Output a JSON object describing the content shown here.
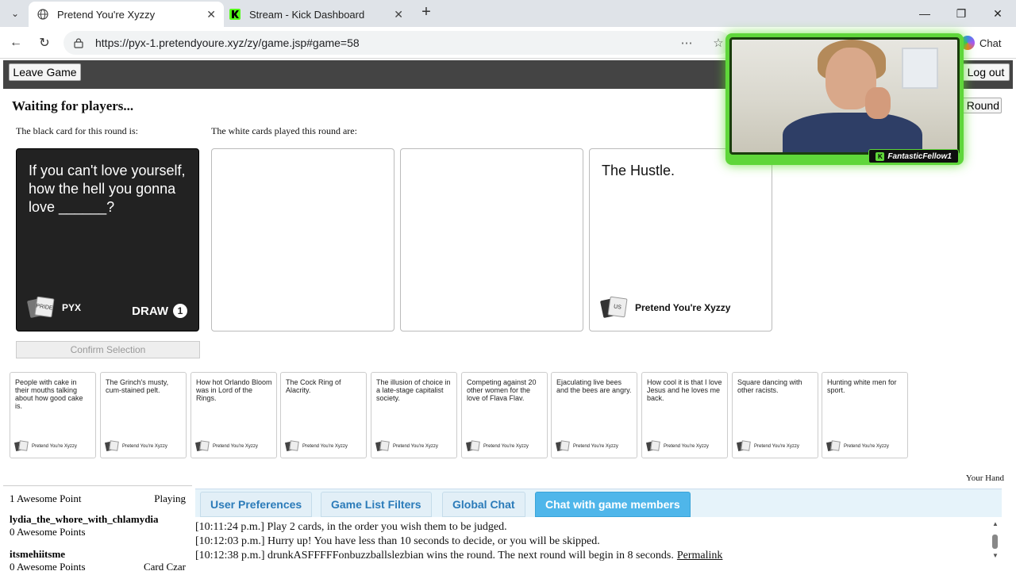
{
  "browser": {
    "tabs": [
      {
        "title": "Pretend You're Xyzzy",
        "active": true
      },
      {
        "title": "Stream - Kick Dashboard",
        "active": false
      }
    ],
    "url": "https://pyx-1.pretendyoure.xyz/zy/game.jsp#game=58",
    "chat_label": "Chat"
  },
  "game": {
    "leave_label": "Leave Game",
    "logout_label": "Log out",
    "round_label": "st Round",
    "status": "Waiting for players...",
    "black_caption": "The black card for this round is:",
    "white_caption": "The white cards played this round are:",
    "black_card": {
      "text": "If you can't love yourself, how the hell you gonna love ______?",
      "logo_text": "PRIDE",
      "brand": "PYX",
      "draw_label": "DRAW",
      "draw_count": "1"
    },
    "played_cards": [
      {
        "text": ""
      },
      {
        "text": ""
      },
      {
        "text": "The Hustle.",
        "logo_text": "US",
        "footer": "Pretend You're Xyzzy"
      }
    ],
    "confirm_label": "Confirm Selection",
    "your_hand_label": "Your Hand",
    "hand": [
      {
        "text": "People with cake in their mouths talking about how good cake is.",
        "footer": "Pretend You're Xyzzy"
      },
      {
        "text": "The Grinch's musty, cum-stained pelt.",
        "footer": "Pretend You're Xyzzy"
      },
      {
        "text": "How hot Orlando Bloom was in Lord of the Rings.",
        "footer": "Pretend You're Xyzzy"
      },
      {
        "text": "The Cock Ring of Alacrity.",
        "footer": "Pretend You're Xyzzy"
      },
      {
        "text": "The illusion of choice in a late-stage capitalist society.",
        "footer": "Pretend You're Xyzzy"
      },
      {
        "text": "Competing against 20 other women for the love of Flava Flav.",
        "footer": "Pretend You're Xyzzy"
      },
      {
        "text": "Ejaculating live bees and the bees are angry.",
        "footer": "Pretend You're Xyzzy"
      },
      {
        "text": "How cool it is that I love Jesus and he loves me back.",
        "footer": "Pretend You're Xyzzy"
      },
      {
        "text": "Square dancing with other racists.",
        "footer": "Pretend You're Xyzzy"
      },
      {
        "text": "Hunting white men for sport.",
        "footer": "Pretend You're Xyzzy"
      }
    ]
  },
  "scoreboard": {
    "rows": [
      {
        "name": "",
        "score": "1 Awesome Point",
        "status": "Playing"
      },
      {
        "name": "lydia_the_whore_with_chlamydia",
        "score": "0 Awesome Points",
        "status": ""
      },
      {
        "name": "itsmehiitsme",
        "score": "0 Awesome Points",
        "status": "Card Czar"
      }
    ]
  },
  "panel_tabs": [
    {
      "label": "User Preferences",
      "active": false
    },
    {
      "label": "Game List Filters",
      "active": false
    },
    {
      "label": "Global Chat",
      "active": false
    },
    {
      "label": "Chat with game members",
      "active": true
    }
  ],
  "chat": {
    "lines": [
      {
        "text": "[10:11:24 p.m.] Play 2 cards, in the order you wish them to be judged."
      },
      {
        "text": "[10:12:03 p.m.] Hurry up! You have less than 10 seconds to decide, or you will be skipped."
      },
      {
        "text": "[10:12:38 p.m.] drunkASFFFFFonbuzzballslezbian wins the round. The next round will begin in 8 seconds.",
        "link": "Permalink"
      }
    ]
  },
  "webcam": {
    "name": "FantasticFellow1"
  }
}
